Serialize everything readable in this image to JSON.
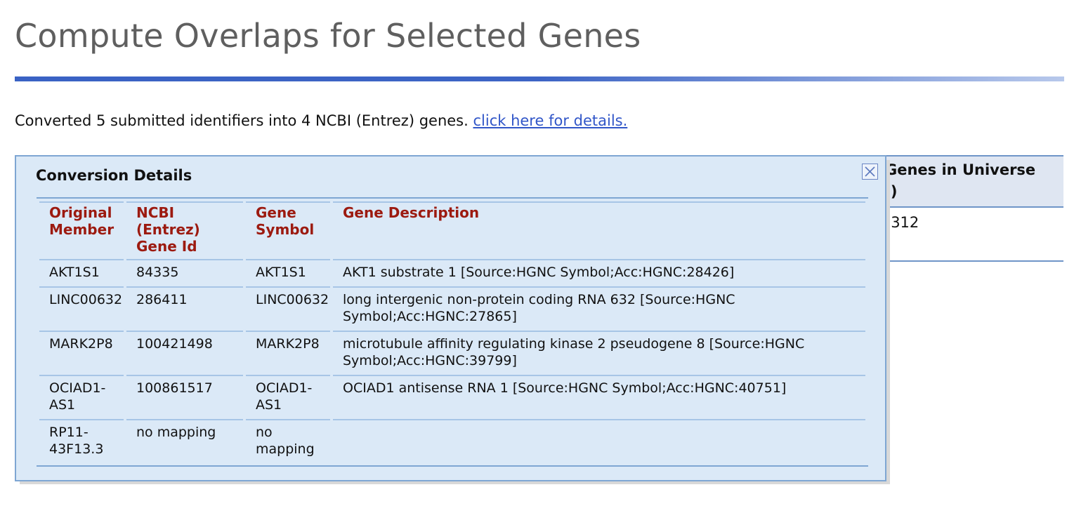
{
  "page": {
    "title": "Compute Overlaps for Selected Genes",
    "summary_text": "Converted 5 submitted identifiers into 4 NCBI (Entrez) genes.",
    "details_link": "click here for details."
  },
  "background_table": {
    "header_visible": "Genes in Universe\nI)",
    "cell_visible": ")312"
  },
  "popup": {
    "title": "Conversion Details",
    "close_icon": "close-x-icon",
    "columns": [
      "Original Member",
      "NCBI (Entrez) Gene Id",
      "Gene Symbol",
      "Gene Description"
    ],
    "rows": [
      [
        "AKT1S1",
        "84335",
        "AKT1S1",
        "AKT1 substrate 1 [Source:HGNC Symbol;Acc:HGNC:28426]"
      ],
      [
        "LINC00632",
        "286411",
        "LINC00632",
        "long intergenic non-protein coding RNA 632 [Source:HGNC Symbol;Acc:HGNC:27865]"
      ],
      [
        "MARK2P8",
        "100421498",
        "MARK2P8",
        "microtubule affinity regulating kinase 2 pseudogene 8 [Source:HGNC Symbol;Acc:HGNC:39799]"
      ],
      [
        "OCIAD1-AS1",
        "100861517",
        "OCIAD1-AS1",
        "OCIAD1 antisense RNA 1 [Source:HGNC Symbol;Acc:HGNC:40751]"
      ],
      [
        "RP11-43F13.3",
        "no mapping",
        "no mapping",
        ""
      ]
    ]
  },
  "colors": {
    "accent": "#3a62c4",
    "link": "#3156c8",
    "header_text": "#9c1a10",
    "popup_bg": "#dbe9f7"
  }
}
